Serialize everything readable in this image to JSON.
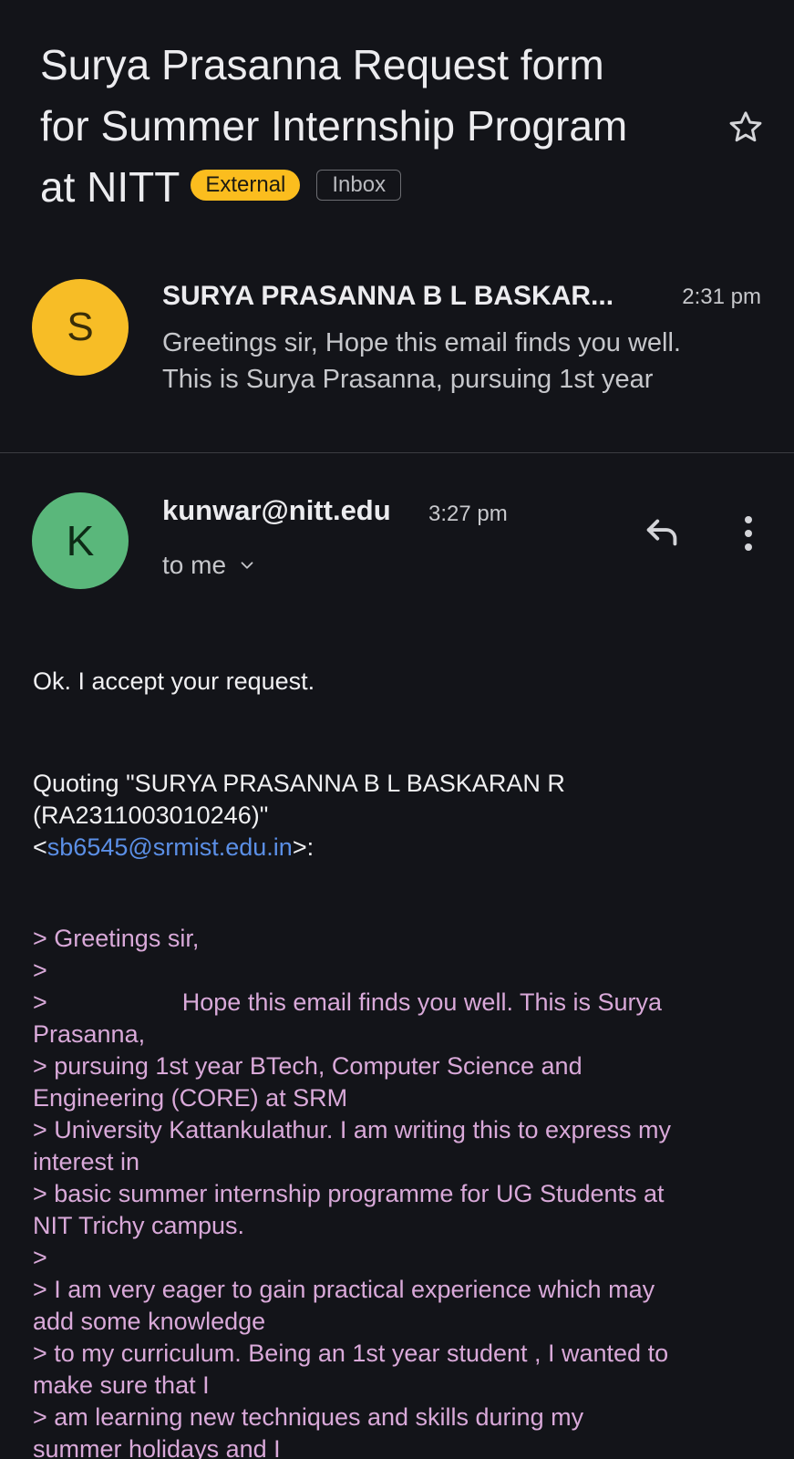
{
  "subject": {
    "line1": "Surya Prasanna Request form",
    "line2": "for Summer  Internship Program",
    "line3": "at NITT",
    "labels": [
      "External",
      "Inbox"
    ]
  },
  "thread": [
    {
      "avatar_letter": "S",
      "sender": "SURYA PRASANNA B L BASKAR...",
      "time": "2:31 pm",
      "snippet_line1": "Greetings sir, Hope this email finds you well.",
      "snippet_line2": "This is Surya Prasanna, pursuing 1st year"
    },
    {
      "avatar_letter": "K",
      "sender": "kunwar@nitt.edu",
      "time": "3:27 pm",
      "recipient": "to me"
    }
  ],
  "body": {
    "reply": "Ok. I accept your request.",
    "quoting_line1": "Quoting \"SURYA PRASANNA B L BASKARAN R",
    "quoting_line2": "(RA2311003010246)\"",
    "email_open": "<",
    "email": "sb6545@srmist.edu.in",
    "email_close": ">:",
    "quoted_lines": [
      "> Greetings sir,",
      ">",
      ">",
      "Hope this email finds you well. This is Surya",
      "Prasanna,",
      "> pursuing 1st year BTech, Computer Science and",
      "Engineering (CORE) at SRM",
      "> University Kattankulathur. I am  writing this to express my",
      "interest in",
      "> basic summer  internship programme for UG Students at",
      "NIT Trichy campus.",
      ">",
      "> I am very eager to gain practical experience which may",
      "add some knowledge",
      "> to my curriculum. Being an 1st year student , I wanted to",
      "make sure that I",
      "> am  learning new techniques and skills   during my",
      "summer holidays and I"
    ]
  },
  "colors": {
    "background": "#131419",
    "external_chip": "#fbbd1e",
    "avatar_s": "#f7bd26",
    "avatar_k": "#5ab77b",
    "link": "#5b8fe6",
    "quoted_text": "#d9a9d9"
  },
  "icons": {
    "star": "star-icon",
    "reply": "reply-icon",
    "more": "more-vert-icon",
    "expand": "chevron-down-icon"
  }
}
